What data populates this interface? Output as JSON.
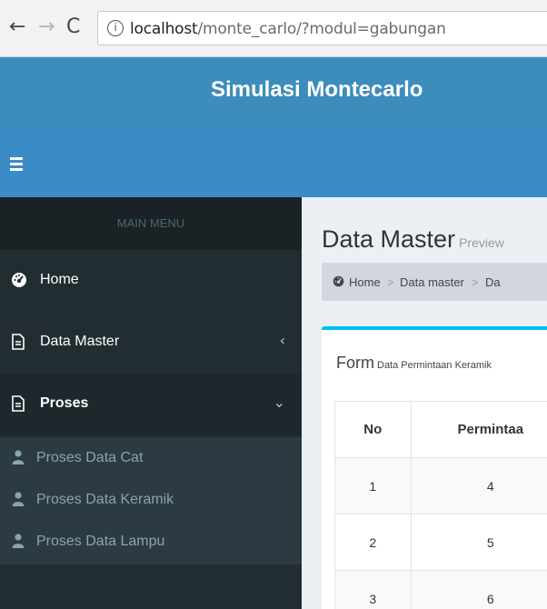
{
  "browser": {
    "url_host": "localhost",
    "url_path": "/monte_carlo/?modul=gabungan"
  },
  "app": {
    "title": "Simulasi Montecarlo"
  },
  "sidebar": {
    "header": "MAIN MENU",
    "items": [
      {
        "label": "Home",
        "icon": "dashboard-icon"
      },
      {
        "label": "Data Master",
        "icon": "file-icon"
      },
      {
        "label": "Proses",
        "icon": "file-icon"
      }
    ],
    "submenu": [
      {
        "label": "Proses Data Cat",
        "icon": "user-icon"
      },
      {
        "label": "Proses Data Keramik",
        "icon": "user-icon"
      },
      {
        "label": "Proses Data Lampu",
        "icon": "user-icon"
      }
    ]
  },
  "content": {
    "title": "Data Master",
    "subtitle": "Preview",
    "breadcrumb": [
      "Home",
      "Data master",
      "Da"
    ],
    "box": {
      "title": "Form",
      "subtitle": "Data Permintaan Keramik",
      "table": {
        "headers": [
          "No",
          "Permintaa"
        ],
        "rows": [
          [
            "1",
            "4"
          ],
          [
            "2",
            "5"
          ],
          [
            "3",
            "6"
          ]
        ]
      }
    }
  },
  "colors": {
    "header": "#3c8dbc",
    "sidebar": "#222d32",
    "box_accent": "#00c0ef"
  }
}
